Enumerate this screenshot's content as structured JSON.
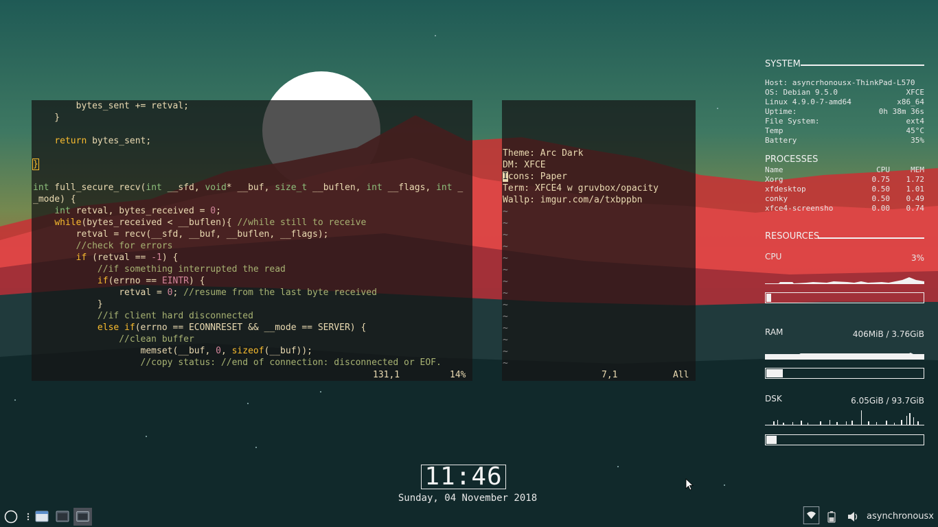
{
  "desktop": {
    "wallpaper": {
      "sky_top": "#2f6a5c",
      "sky_bottom": "#7a8a52",
      "mountain_color": "#c9383c",
      "foreground": "#0f2a2c",
      "moon_color": "#ffffff"
    }
  },
  "left_terminal": {
    "lines": [
      {
        "text": "        bytes_sent += retval;",
        "style": "plain"
      },
      {
        "text": "    }",
        "style": "plain"
      },
      {
        "text": "",
        "style": "plain"
      },
      {
        "text": "    return bytes_sent;",
        "style": "return"
      },
      {
        "text": "",
        "style": "plain"
      },
      {
        "text": "}",
        "style": "brace-cursor"
      },
      {
        "text": "",
        "style": "plain"
      },
      {
        "text": "int full_secure_recv(int __sfd, void* __buf, size_t __buflen, int __flags, int _",
        "style": "sig"
      },
      {
        "text": "_mode) {",
        "style": "plain"
      },
      {
        "text": "    int retval, bytes_received = 0;",
        "style": "decl"
      },
      {
        "text": "    while(bytes_received < __buflen){ //while still to receive",
        "style": "while"
      },
      {
        "text": "        retval = recv(__sfd, __buf, __buflen, __flags);",
        "style": "plain"
      },
      {
        "text": "        //check for errors",
        "style": "comment"
      },
      {
        "text": "        if (retval == -1) {",
        "style": "if"
      },
      {
        "text": "            //if something interrupted the read",
        "style": "comment"
      },
      {
        "text": "            if(errno == EINTR) {",
        "style": "ifeintr"
      },
      {
        "text": "                retval = 0; //resume from the last byte received",
        "style": "resume"
      },
      {
        "text": "            }",
        "style": "plain"
      },
      {
        "text": "            //if client hard disconnected",
        "style": "comment"
      },
      {
        "text": "            else if(errno == ECONNRESET && __mode == SERVER) {",
        "style": "elseif"
      },
      {
        "text": "                //clean buffer",
        "style": "comment"
      },
      {
        "text": "                    memset(__buf, 0, sizeof(__buf));",
        "style": "memset"
      },
      {
        "text": "                    //copy status: //end of connection: disconnected or EOF.",
        "style": "comment"
      }
    ],
    "status_pos": "131,1",
    "status_pct": "14%"
  },
  "right_terminal": {
    "lines": [
      "Theme: Arc Dark",
      "DM: XFCE",
      "Icons: Paper",
      "Term: XFCE4 w gruvbox/opacity",
      "Wallp: imgur.com/a/txbppbn"
    ],
    "tildes": [
      "~",
      "~",
      "~",
      "~",
      "~",
      "~",
      "~",
      "~",
      "~",
      "~",
      "~",
      "~",
      "~",
      "~"
    ],
    "status_pos": "7,1",
    "status_pct": "All"
  },
  "conky": {
    "system": {
      "heading": "SYSTEM",
      "host": "Host: asyncrhonousx-ThinkPad-L570",
      "os_label": "OS: Debian 9.5.0",
      "os_value": "XFCE",
      "kernel_label": "Linux 4.9.0-7-amd64",
      "kernel_value": "x86_64",
      "uptime_label": "Uptime:",
      "uptime_value": "0h 38m 36s",
      "fs_label": "File System:",
      "fs_value": "ext4",
      "temp_label": "Temp",
      "temp_value": "45°C",
      "battery_label": "Battery",
      "battery_value": "35%"
    },
    "processes": {
      "heading": "PROCESSES",
      "col_name": "Name",
      "col_cpu": "CPU",
      "col_mem": "MEM",
      "rows": [
        {
          "name": "Xorg",
          "cpu": "0.75",
          "mem": "1.72"
        },
        {
          "name": "xfdesktop",
          "cpu": "0.50",
          "mem": "1.01"
        },
        {
          "name": "conky",
          "cpu": "0.50",
          "mem": "0.49"
        },
        {
          "name": "xfce4-screensho",
          "cpu": "0.00",
          "mem": "0.74"
        }
      ]
    },
    "resources": {
      "heading": "RESOURCES",
      "cpu_label": "CPU",
      "cpu_value": "3%",
      "cpu_fraction": 0.03,
      "ram_label": "RAM",
      "ram_value": "406MiB / 3.76GiB",
      "ram_fraction": 0.105,
      "dsk_label": "DSK",
      "dsk_value": "6.05GiB / 93.7GiB",
      "dsk_fraction": 0.065
    }
  },
  "clock": {
    "time": "11:46",
    "date": "Sunday, 04 November 2018"
  },
  "panel": {
    "username": "asynchronousx",
    "icons": [
      "whisker-menu-icon",
      "separator-dots-icon",
      "file-manager-icon",
      "terminal-icon",
      "active-terminal-icon",
      "wifi-icon",
      "battery-icon",
      "volume-icon"
    ]
  }
}
